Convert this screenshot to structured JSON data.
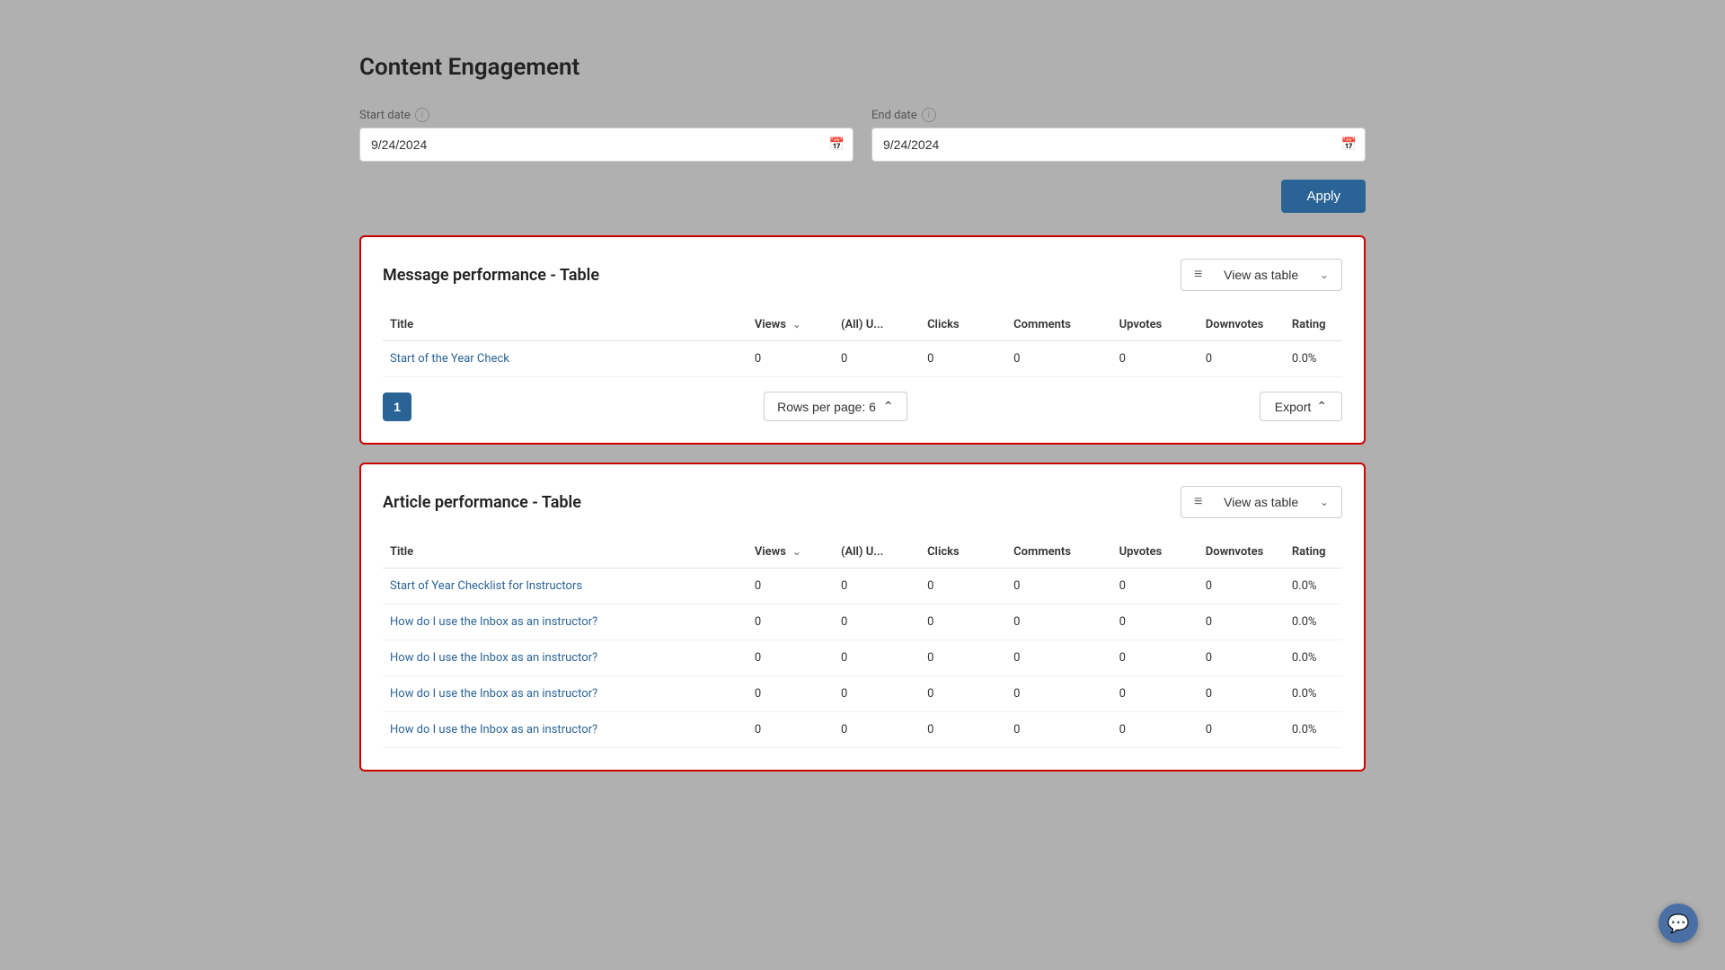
{
  "page": {
    "title": "Content Engagement"
  },
  "filters": {
    "start_date_label": "Start date",
    "end_date_label": "End date",
    "start_date_value": "9/24/2024",
    "end_date_value": "9/24/2024",
    "apply_label": "Apply"
  },
  "message_performance": {
    "section_title": "Message performance - Table",
    "view_as_table_label": "View as table",
    "columns": {
      "title": "Title",
      "views": "Views",
      "all_users": "(All) U...",
      "clicks": "Clicks",
      "comments": "Comments",
      "upvotes": "Upvotes",
      "downvotes": "Downvotes",
      "rating": "Rating"
    },
    "rows": [
      {
        "title": "Start of the Year Check",
        "link": "#",
        "views": "0",
        "all_users": "0",
        "clicks": "0",
        "comments": "0",
        "upvotes": "0",
        "downvotes": "0",
        "rating": "0.0%"
      }
    ],
    "pagination": {
      "current_page": "1",
      "rows_per_page_label": "Rows per page: 6",
      "export_label": "Export"
    }
  },
  "article_performance": {
    "section_title": "Article performance - Table",
    "view_as_table_label": "View as table",
    "columns": {
      "title": "Title",
      "views": "Views",
      "all_users": "(All) U...",
      "clicks": "Clicks",
      "comments": "Comments",
      "upvotes": "Upvotes",
      "downvotes": "Downvotes",
      "rating": "Rating"
    },
    "rows": [
      {
        "title": "Start of Year Checklist for Instructors",
        "link": "#",
        "views": "0",
        "all_users": "0",
        "clicks": "0",
        "comments": "0",
        "upvotes": "0",
        "downvotes": "0",
        "rating": "0.0%"
      },
      {
        "title": "How do I use the Inbox as an instructor?",
        "link": "#",
        "views": "0",
        "all_users": "0",
        "clicks": "0",
        "comments": "0",
        "upvotes": "0",
        "downvotes": "0",
        "rating": "0.0%"
      },
      {
        "title": "How do I use the Inbox as an instructor?",
        "link": "#",
        "views": "0",
        "all_users": "0",
        "clicks": "0",
        "comments": "0",
        "upvotes": "0",
        "downvotes": "0",
        "rating": "0.0%"
      },
      {
        "title": "How do I use the Inbox as an instructor?",
        "link": "#",
        "views": "0",
        "all_users": "0",
        "clicks": "0",
        "comments": "0",
        "upvotes": "0",
        "downvotes": "0",
        "rating": "0.0%"
      },
      {
        "title": "How do I use the Inbox as an instructor?",
        "link": "#",
        "views": "0",
        "all_users": "0",
        "clicks": "0",
        "comments": "0",
        "upvotes": "0",
        "downvotes": "0",
        "rating": "0.0%"
      }
    ]
  },
  "icons": {
    "calendar": "📅",
    "table_list": "≡",
    "chevron_down": "∨",
    "chevron_up": "∧",
    "sort": "∨",
    "chat": "💬",
    "info": "i"
  }
}
